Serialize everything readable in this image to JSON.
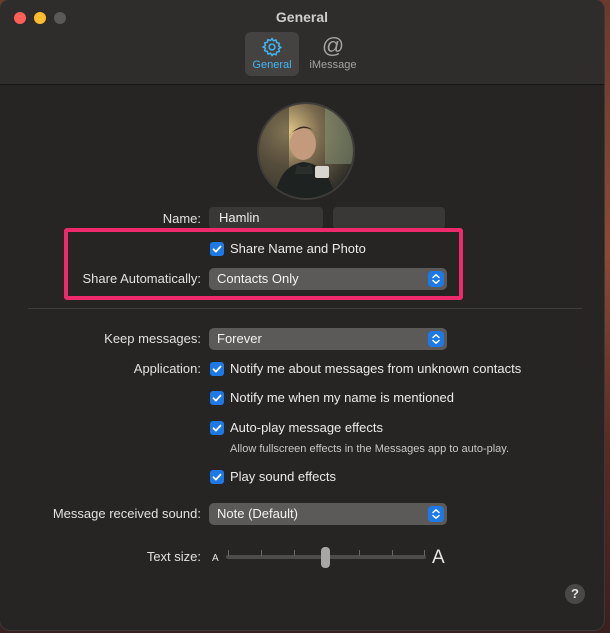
{
  "window": {
    "title": "General"
  },
  "toolbar": {
    "tabs": [
      {
        "label": "General",
        "icon": "gear-icon",
        "active": true
      },
      {
        "label": "iMessage",
        "icon": "at-icon",
        "active": false
      }
    ]
  },
  "profile": {
    "name_label": "Name:",
    "first_name": "Hamlin",
    "last_name": "",
    "share_name_photo": {
      "label": "Share Name and Photo",
      "checked": true
    },
    "share_auto_label": "Share Automatically:",
    "share_auto_value": "Contacts Only"
  },
  "settings": {
    "keep_messages_label": "Keep messages:",
    "keep_messages_value": "Forever",
    "application_label": "Application:",
    "options": [
      {
        "label": "Notify me about messages from unknown contacts",
        "checked": true
      },
      {
        "label": "Notify me when my name is mentioned",
        "checked": true
      },
      {
        "label": "Auto-play message effects",
        "checked": true
      },
      {
        "label": "Play sound effects",
        "checked": true
      }
    ],
    "auto_play_subtext": "Allow fullscreen effects in the Messages app to auto-play.",
    "sound_label": "Message received sound:",
    "sound_value": "Note (Default)",
    "text_size_label": "Text size:",
    "text_size_small": "A",
    "text_size_large": "A",
    "text_size_level": 0.5
  },
  "help": {
    "label": "?"
  },
  "colors": {
    "accent": "#1e78e6",
    "highlight": "#ee2a6d",
    "tab_active": "#42b6f4"
  }
}
